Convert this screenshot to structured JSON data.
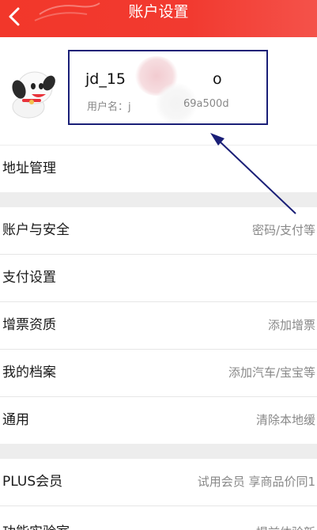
{
  "header": {
    "title": "账户设置"
  },
  "profile": {
    "username": "jd_15",
    "username_tail": "o",
    "userid_label": "用户名：j",
    "userid_tail": "69a500d"
  },
  "menu": [
    {
      "label": "地址管理",
      "value": ""
    },
    {
      "label": "账户与安全",
      "value": "密码/支付等"
    },
    {
      "label": "支付设置",
      "value": ""
    },
    {
      "label": "增票资质",
      "value": "添加增票"
    },
    {
      "label": "我的档案",
      "value": "添加汽车/宝宝等"
    },
    {
      "label": "通用",
      "value": "清除本地缓"
    },
    {
      "label": "PLUS会员",
      "value": "试用会员 享商品价同1"
    },
    {
      "label": "功能实验室",
      "value": "提前体验新"
    }
  ],
  "colors": {
    "header": "#f2372a",
    "annotation": "#1a1f77"
  }
}
